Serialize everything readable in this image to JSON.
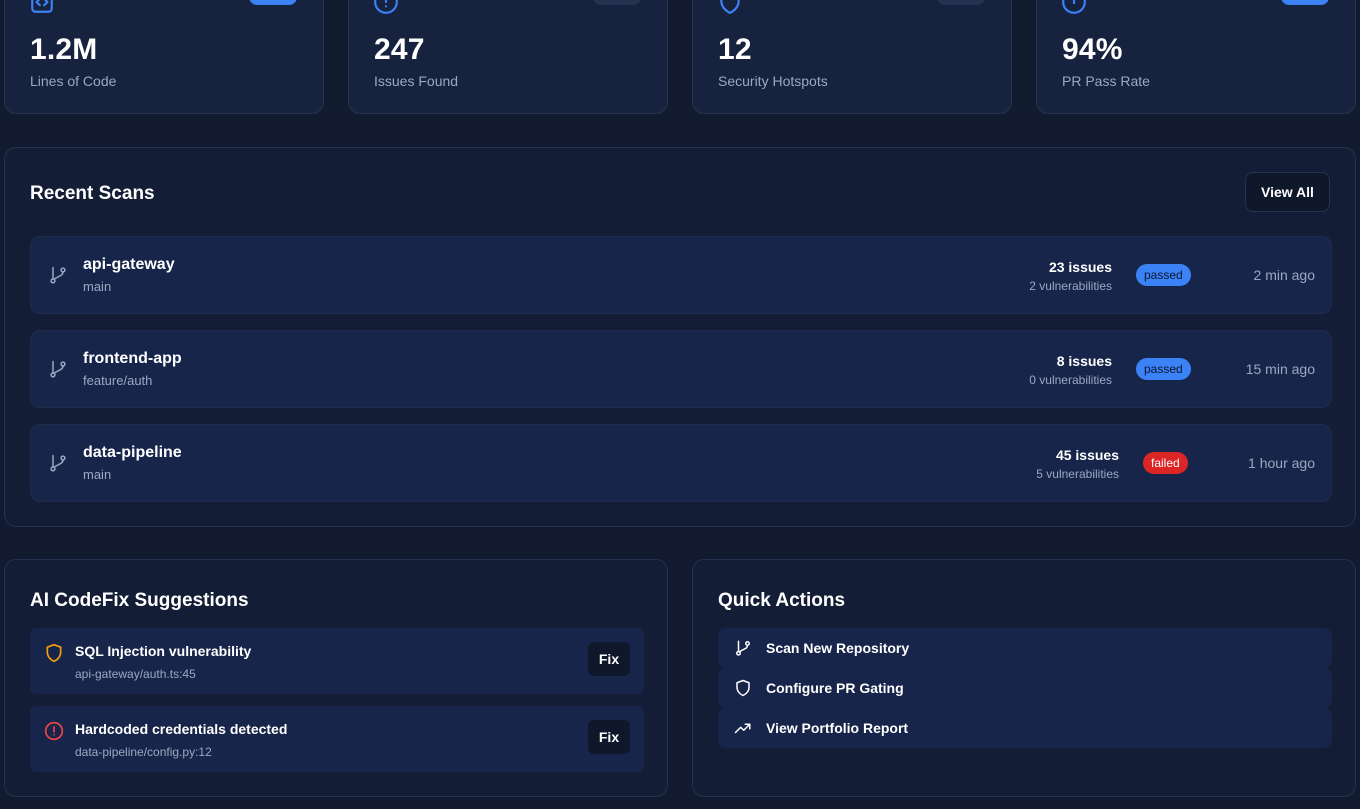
{
  "stats": [
    {
      "value": "1.2M",
      "label": "Lines of Code",
      "icon": "code-icon",
      "badge_color": "#3b82f6"
    },
    {
      "value": "247",
      "label": "Issues Found",
      "icon": "alert-circle-icon",
      "badge_color": "#263350"
    },
    {
      "value": "12",
      "label": "Security Hotspots",
      "icon": "shield-icon",
      "badge_color": "#263350"
    },
    {
      "value": "94%",
      "label": "PR Pass Rate",
      "icon": "check-circle-icon",
      "badge_color": "#3b82f6"
    }
  ],
  "recent_scans": {
    "title": "Recent Scans",
    "view_all_label": "View All",
    "rows": [
      {
        "repo": "api-gateway",
        "branch": "main",
        "issues": "23 issues",
        "vulnerabilities": "2 vulnerabilities",
        "status": "passed",
        "time": "2 min ago"
      },
      {
        "repo": "frontend-app",
        "branch": "feature/auth",
        "issues": "8 issues",
        "vulnerabilities": "0 vulnerabilities",
        "status": "passed",
        "time": "15 min ago"
      },
      {
        "repo": "data-pipeline",
        "branch": "main",
        "issues": "45 issues",
        "vulnerabilities": "5 vulnerabilities",
        "status": "failed",
        "time": "1 hour ago"
      }
    ]
  },
  "codefix": {
    "title": "AI CodeFix Suggestions",
    "items": [
      {
        "title": "SQL Injection vulnerability",
        "path": "api-gateway/auth.ts:45",
        "icon": "shield-warning-icon",
        "color": "#f59e0b",
        "button_label": "Fix"
      },
      {
        "title": "Hardcoded credentials detected",
        "path": "data-pipeline/config.py:12",
        "icon": "alert-circle-icon",
        "color": "#ef4444",
        "button_label": "Fix"
      }
    ]
  },
  "quick_actions": {
    "title": "Quick Actions",
    "items": [
      {
        "label": "Scan New Repository",
        "icon": "git-branch-icon"
      },
      {
        "label": "Configure PR Gating",
        "icon": "shield-icon"
      },
      {
        "label": "View Portfolio Report",
        "icon": "trending-up-icon"
      }
    ]
  },
  "colors": {
    "accent": "#3b82f6",
    "danger": "#dc2626",
    "warning": "#f59e0b",
    "background": "#111a2e",
    "panel": "#131d35",
    "row": "#18254a"
  }
}
